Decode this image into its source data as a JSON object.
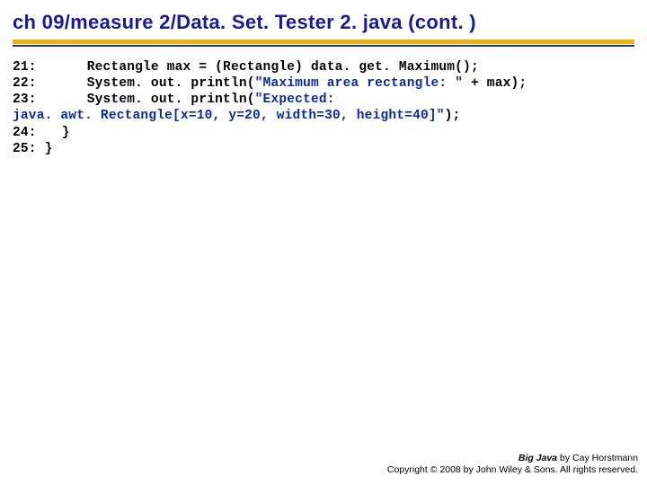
{
  "title": "ch 09/measure 2/Data. Set. Tester 2. java  (cont. )",
  "code": {
    "l21_num": "21:",
    "l21_txt": "Rectangle max = (Rectangle) data. get. Maximum();",
    "l22_num": "22:",
    "l22_a": "System. out. println(",
    "l22_str": "\"Maximum area rectangle: \"",
    "l22_b": " + max);",
    "l23_num": "23:",
    "l23_a": "System. out. println(",
    "l23_str": "\"Expected:",
    "wrap_a": "java. awt. Rectangle[x=10, y=20, width=30, height=40]\"",
    "wrap_b": ");",
    "l24_num": "24:",
    "l24_txt": "}",
    "l25_num": "25:",
    "l25_txt": " }"
  },
  "footer": {
    "line1_a": "Big Java",
    "line1_b": " by Cay Horstmann",
    "line2": "Copyright © 2008 by John Wiley & Sons. All rights reserved."
  }
}
